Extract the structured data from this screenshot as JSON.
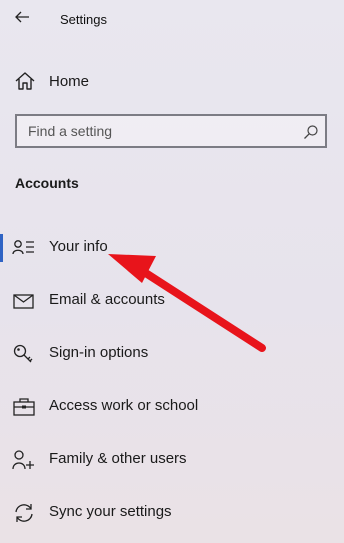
{
  "window": {
    "title": "Settings"
  },
  "nav": {
    "home_label": "Home"
  },
  "search": {
    "placeholder": "Find a setting"
  },
  "section": {
    "title": "Accounts"
  },
  "items": [
    {
      "label": "Your info",
      "icon": "person-card-icon",
      "selected": true
    },
    {
      "label": "Email & accounts",
      "icon": "mail-icon"
    },
    {
      "label": "Sign-in options",
      "icon": "key-icon"
    },
    {
      "label": "Access work or school",
      "icon": "briefcase-icon"
    },
    {
      "label": "Family & other users",
      "icon": "add-person-icon"
    },
    {
      "label": "Sync your settings",
      "icon": "sync-icon"
    }
  ],
  "colors": {
    "accent": "#2f63c4",
    "annotation_arrow": "#e8141b"
  }
}
